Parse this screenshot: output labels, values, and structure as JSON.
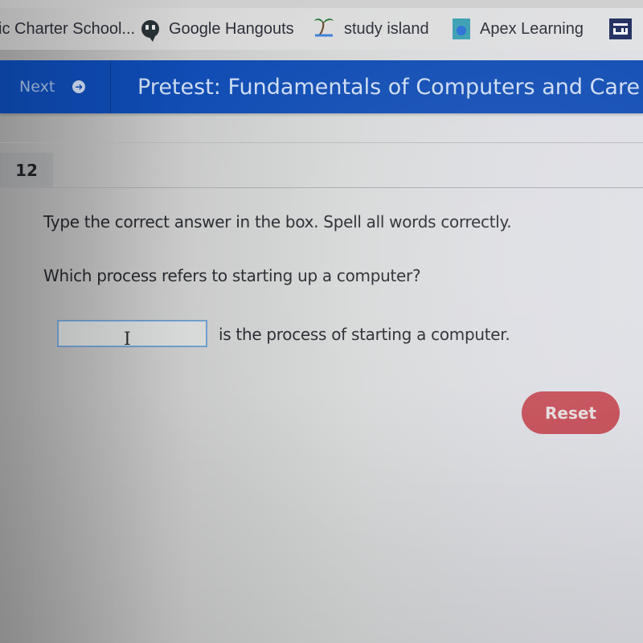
{
  "bookmarks": [
    {
      "label": "ic Charter School...",
      "icon": "none"
    },
    {
      "label": "Google Hangouts",
      "icon": "hangouts-icon"
    },
    {
      "label": "study island",
      "icon": "palm-tree-icon"
    },
    {
      "label": "Apex Learning",
      "icon": "apex-icon"
    },
    {
      "label": "",
      "icon": "layout-icon"
    }
  ],
  "nav": {
    "next_label": "Next",
    "next_icon": "arrow-right-circle-icon",
    "title": "Pretest: Fundamentals of Computers and Care"
  },
  "question": {
    "number": "12",
    "instruction": "Type the correct answer in the box. Spell all words correctly.",
    "prompt": "Which process refers to starting up a computer?",
    "answer_value": "",
    "answer_suffix": "is the process of starting a computer.",
    "reset_label": "Reset"
  },
  "colors": {
    "header_blue": "#0e4bb3",
    "reset_red": "#c44b55",
    "input_border": "#6d9bc9"
  }
}
